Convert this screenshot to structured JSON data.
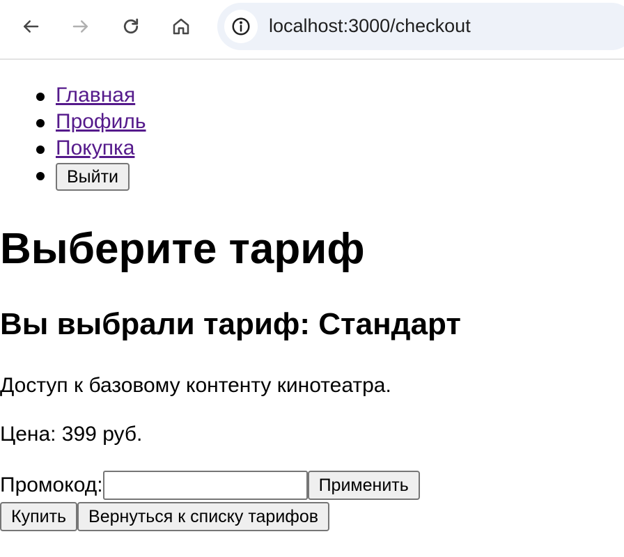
{
  "browser": {
    "url": "localhost:3000/checkout",
    "icons": {
      "back": "arrow-left-icon",
      "forward": "arrow-right-icon",
      "reload": "reload-icon",
      "home": "home-icon",
      "site_info": "info-icon"
    }
  },
  "nav": {
    "links": [
      {
        "label": "Главная"
      },
      {
        "label": "Профиль"
      },
      {
        "label": "Покупка"
      }
    ],
    "logout_label": "Выйти"
  },
  "page": {
    "title": "Выберите тариф",
    "selected_heading": "Вы выбрали тариф: Стандарт",
    "description": "Доступ к базовому контенту кинотеатра.",
    "price": "Цена: 399 руб."
  },
  "promo": {
    "label": "Промокод:",
    "value": "",
    "apply_label": "Применить"
  },
  "actions": {
    "buy_label": "Купить",
    "back_label": "Вернуться к списку тарифов"
  },
  "colors": {
    "link_visited": "#551a8b",
    "omnibox_bg": "#eef2f9",
    "button_bg": "#efefef"
  }
}
